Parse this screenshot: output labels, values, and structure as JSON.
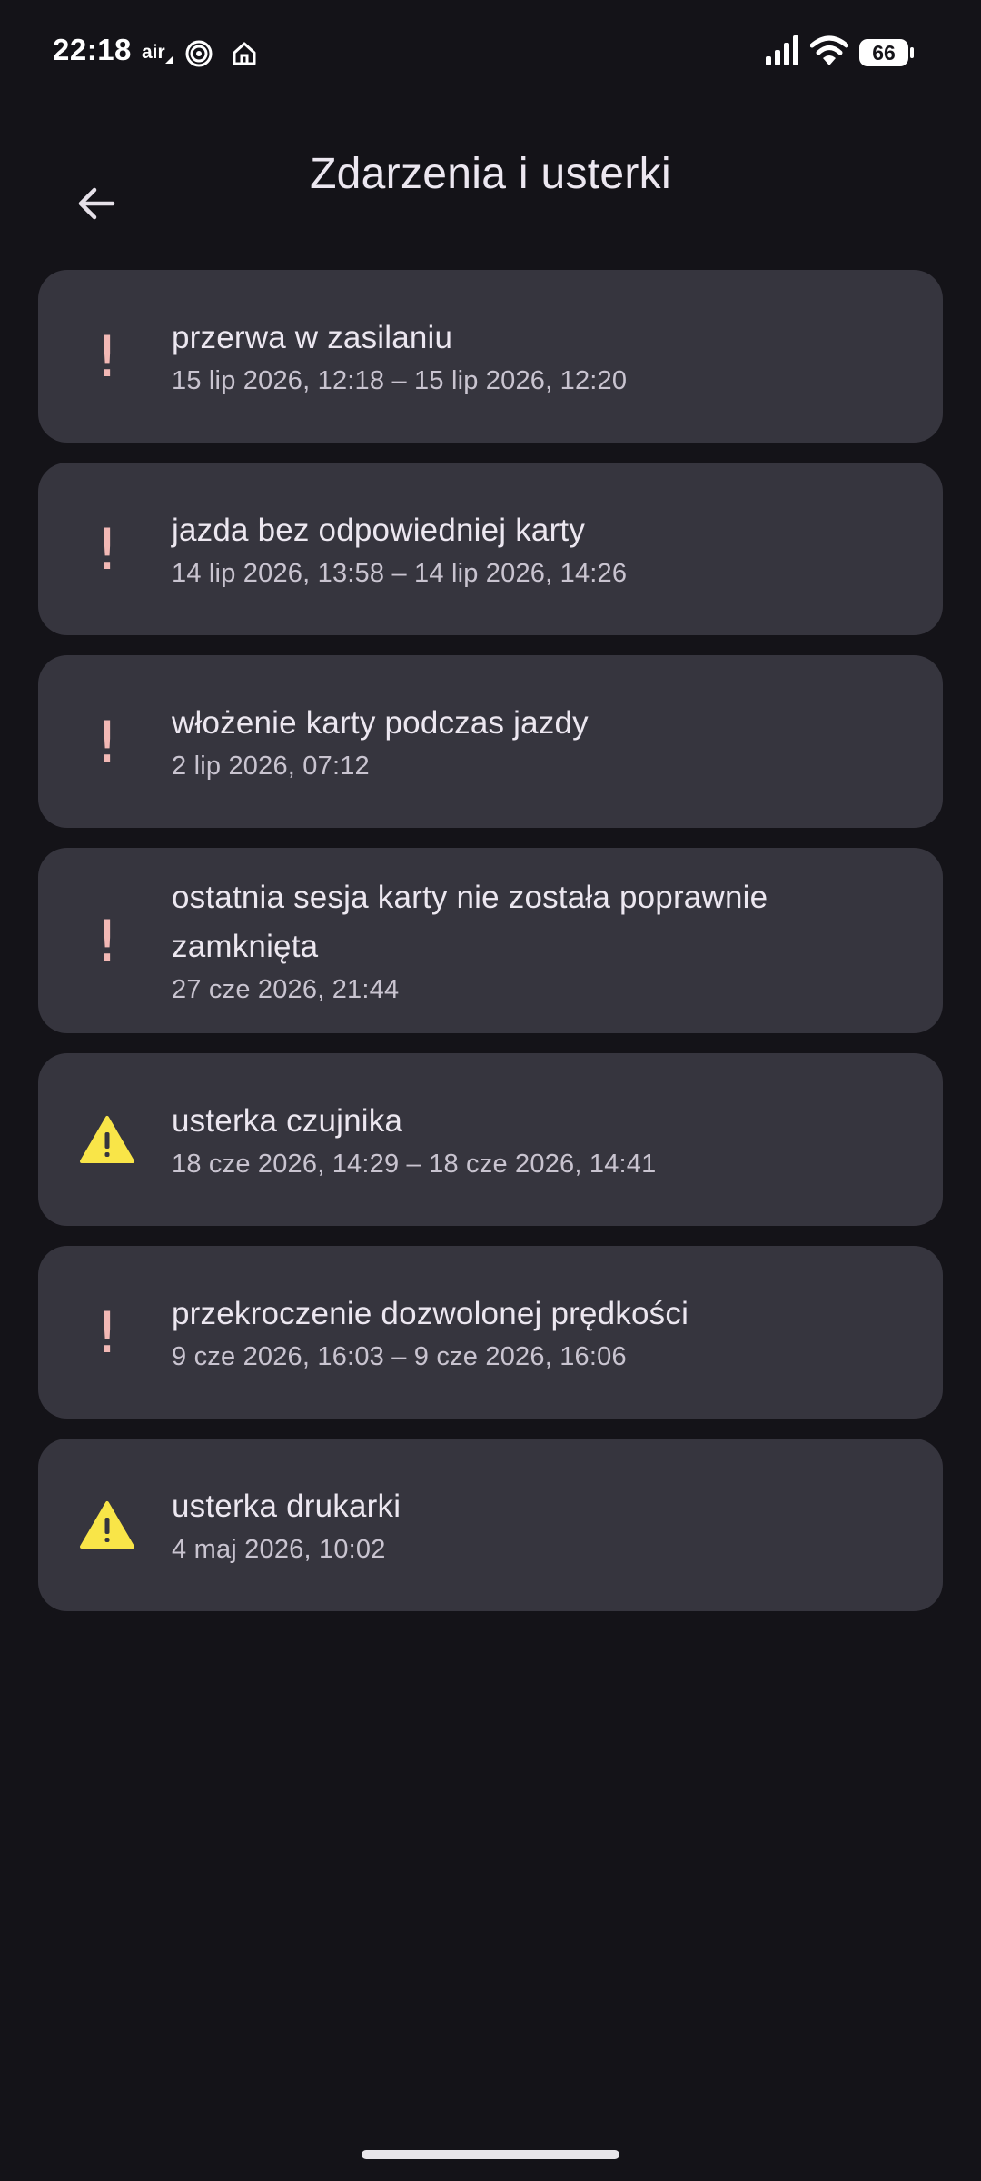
{
  "status_bar": {
    "time": "22:18",
    "air_label": "air",
    "battery_level": "66"
  },
  "app_bar": {
    "title": "Zdarzenia i usterki"
  },
  "colors": {
    "background": "#141318",
    "card": "#36353E",
    "error_icon": "#F2B8B5",
    "warning_icon": "#F9E548"
  },
  "events": [
    {
      "icon": "exclamation-icon",
      "title": "przerwa w zasilaniu",
      "time": "15 lip 2026, 12:18 – 15 lip 2026, 12:20"
    },
    {
      "icon": "exclamation-icon",
      "title": "jazda bez odpowiedniej karty",
      "time": "14 lip 2026, 13:58 – 14 lip 2026, 14:26"
    },
    {
      "icon": "exclamation-icon",
      "title": "włożenie karty podczas jazdy",
      "time": "2 lip 2026, 07:12"
    },
    {
      "icon": "exclamation-icon",
      "title": "ostatnia sesja karty nie została poprawnie zamknięta",
      "time": "27 cze 2026, 21:44"
    },
    {
      "icon": "warning-triangle-icon",
      "title": "usterka czujnika",
      "time": "18 cze 2026, 14:29 – 18 cze 2026, 14:41"
    },
    {
      "icon": "exclamation-icon",
      "title": "przekroczenie dozwolonej prędkości",
      "time": "9 cze 2026, 16:03 – 9 cze 2026, 16:06"
    },
    {
      "icon": "warning-triangle-icon",
      "title": "usterka drukarki",
      "time": "4 maj 2026, 10:02"
    }
  ]
}
